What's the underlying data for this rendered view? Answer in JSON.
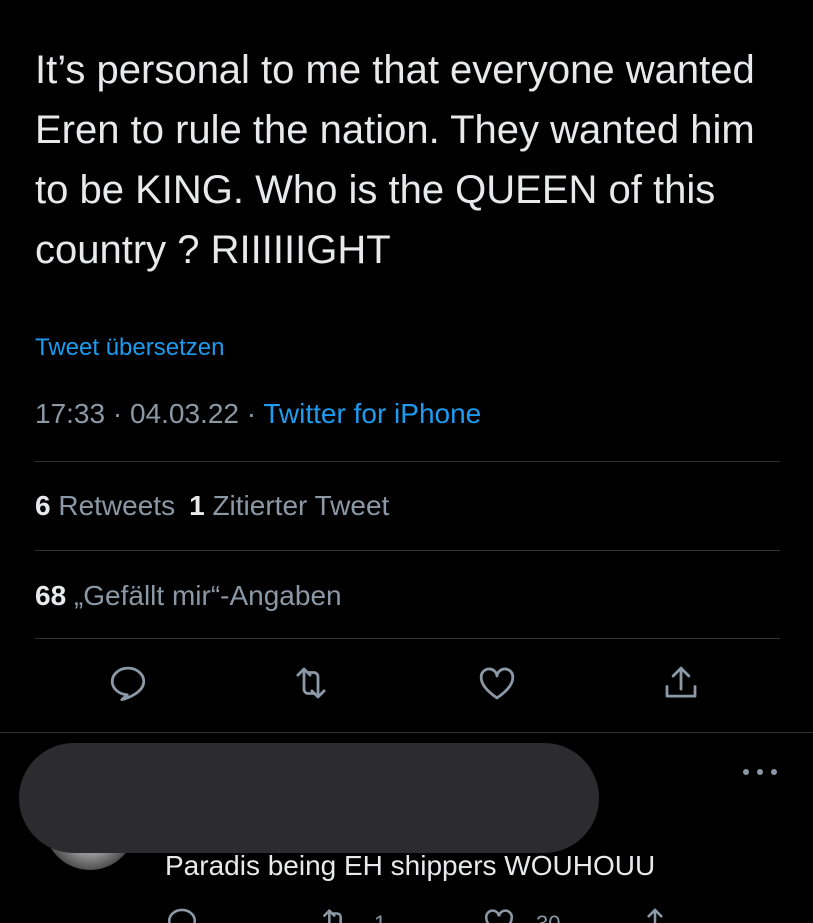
{
  "tweet": {
    "text": "It’s personal to me that everyone wanted Eren to rule the nation. They wanted him to be KING. Who is the QUEEN of this country ? RIIIIIIGHT",
    "translate_label": "Tweet übersetzen",
    "time": "17:33",
    "date": "04.03.22",
    "separator": " · ",
    "source": "Twitter for iPhone"
  },
  "stats": {
    "retweets_count": "6",
    "retweets_label": "Retweets",
    "quotes_count": "1",
    "quotes_label": "Zitierter Tweet",
    "likes_count": "68",
    "likes_label": "„Gefällt mir“-Angaben"
  },
  "actions": {
    "icons": [
      "reply-icon",
      "retweet-icon",
      "like-icon",
      "share-icon"
    ]
  },
  "reply": {
    "text": "Paradis being EH shippers WOUHOUU",
    "retweet_count": "1",
    "like_count": "30"
  },
  "colors": {
    "background": "#000000",
    "text": "#e7e9ea",
    "secondary": "#8b98a5",
    "accent": "#1d9bf0",
    "divider": "#2f3336"
  }
}
